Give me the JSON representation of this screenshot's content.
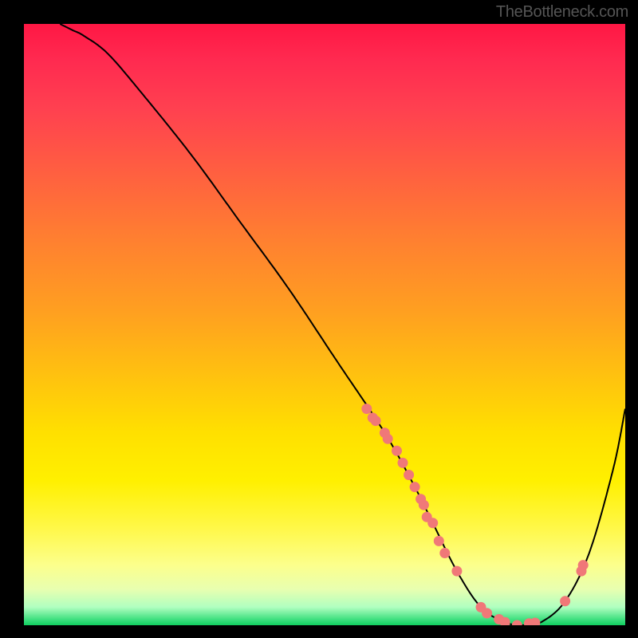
{
  "watermark": "TheBottleneck.com",
  "chart_data": {
    "type": "line",
    "title": "",
    "xlabel": "",
    "ylabel": "",
    "xlim": [
      0,
      100
    ],
    "ylim": [
      0,
      100
    ],
    "grid": false,
    "legend": false,
    "background": "rainbow-gradient-red-to-green",
    "series": [
      {
        "name": "bottleneck-curve",
        "x": [
          6,
          8,
          10,
          14,
          20,
          28,
          36,
          44,
          52,
          60,
          65,
          68,
          72,
          76,
          80,
          83,
          86,
          90,
          94,
          98,
          100
        ],
        "y": [
          100,
          99,
          98,
          95,
          88,
          78,
          67,
          56,
          44,
          32,
          23,
          17,
          9,
          3,
          0.5,
          0,
          0.5,
          4,
          12,
          26,
          36
        ]
      }
    ],
    "scatter_points": {
      "name": "highlighted-points",
      "color": "#f07878",
      "x": [
        57,
        58,
        58.5,
        60,
        60.5,
        62,
        63,
        64,
        65,
        66,
        66.5,
        67,
        68,
        69,
        70,
        72,
        76,
        77,
        79,
        80,
        82,
        84,
        85,
        90,
        93,
        92.7
      ],
      "y": [
        36,
        34.5,
        34,
        32,
        31,
        29,
        27,
        25,
        23,
        21,
        20,
        18,
        17,
        14,
        12,
        9,
        3,
        2,
        1,
        0.5,
        0,
        0.3,
        0.4,
        4,
        10,
        9
      ]
    }
  },
  "colors": {
    "frame": "#000000",
    "curve": "#000000",
    "dots": "#f07878"
  }
}
